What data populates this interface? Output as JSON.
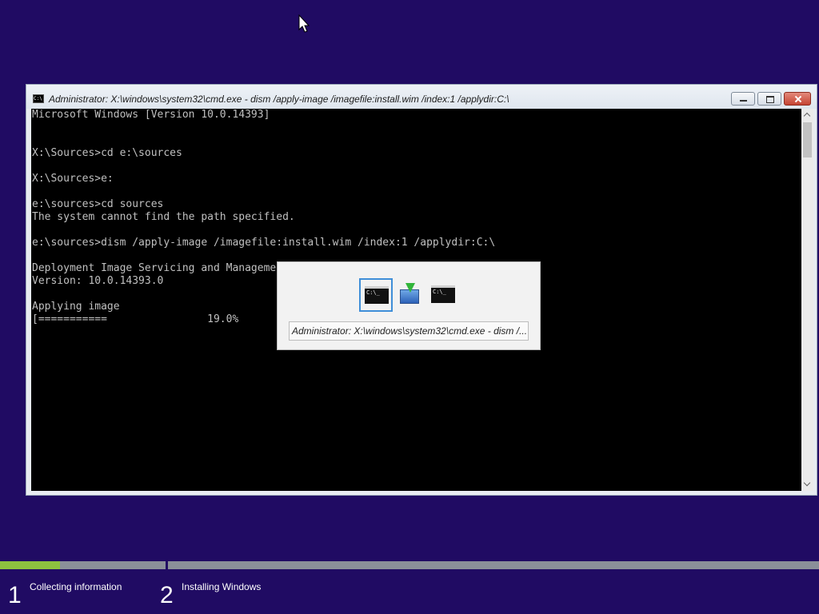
{
  "cursor": {
    "icon": "mouse-pointer-icon"
  },
  "cmd_window": {
    "title": "Administrator: X:\\windows\\system32\\cmd.exe - dism  /apply-image /imagefile:install.wim /index:1 /applydir:C:\\",
    "icon": "cmd-icon",
    "icon_text": "C:\\",
    "console_lines": [
      "Microsoft Windows [Version 10.0.14393]",
      "",
      "",
      "X:\\Sources>cd e:\\sources",
      "",
      "X:\\Sources>e:",
      "",
      "e:\\sources>cd sources",
      "The system cannot find the path specified.",
      "",
      "e:\\sources>dism /apply-image /imagefile:install.wim /index:1 /applydir:C:\\",
      "",
      "Deployment Image Servicing and Manageme",
      "Version: 10.0.14393.0",
      "",
      "Applying image",
      "[===========                19.0%"
    ]
  },
  "task_switcher": {
    "items": [
      {
        "name": "switcher-item-cmd-1",
        "icon": "cmd-icon",
        "text": "C:\\_"
      },
      {
        "name": "switcher-item-setup",
        "icon": "windows-setup-icon",
        "text": ""
      },
      {
        "name": "switcher-item-cmd-2",
        "icon": "cmd-icon",
        "text": "C:\\_"
      }
    ],
    "caption": "Administrator: X:\\windows\\system32\\cmd.exe - dism  /..."
  },
  "setup_progress": {
    "step1_fill_fraction": 0.36,
    "steps": [
      {
        "number": "1",
        "label": "Collecting information"
      },
      {
        "number": "2",
        "label": "Installing Windows"
      }
    ],
    "colors": {
      "background": "#200b63",
      "progress_fill": "#8dc23f",
      "progress_track": "#8a8f99"
    }
  }
}
